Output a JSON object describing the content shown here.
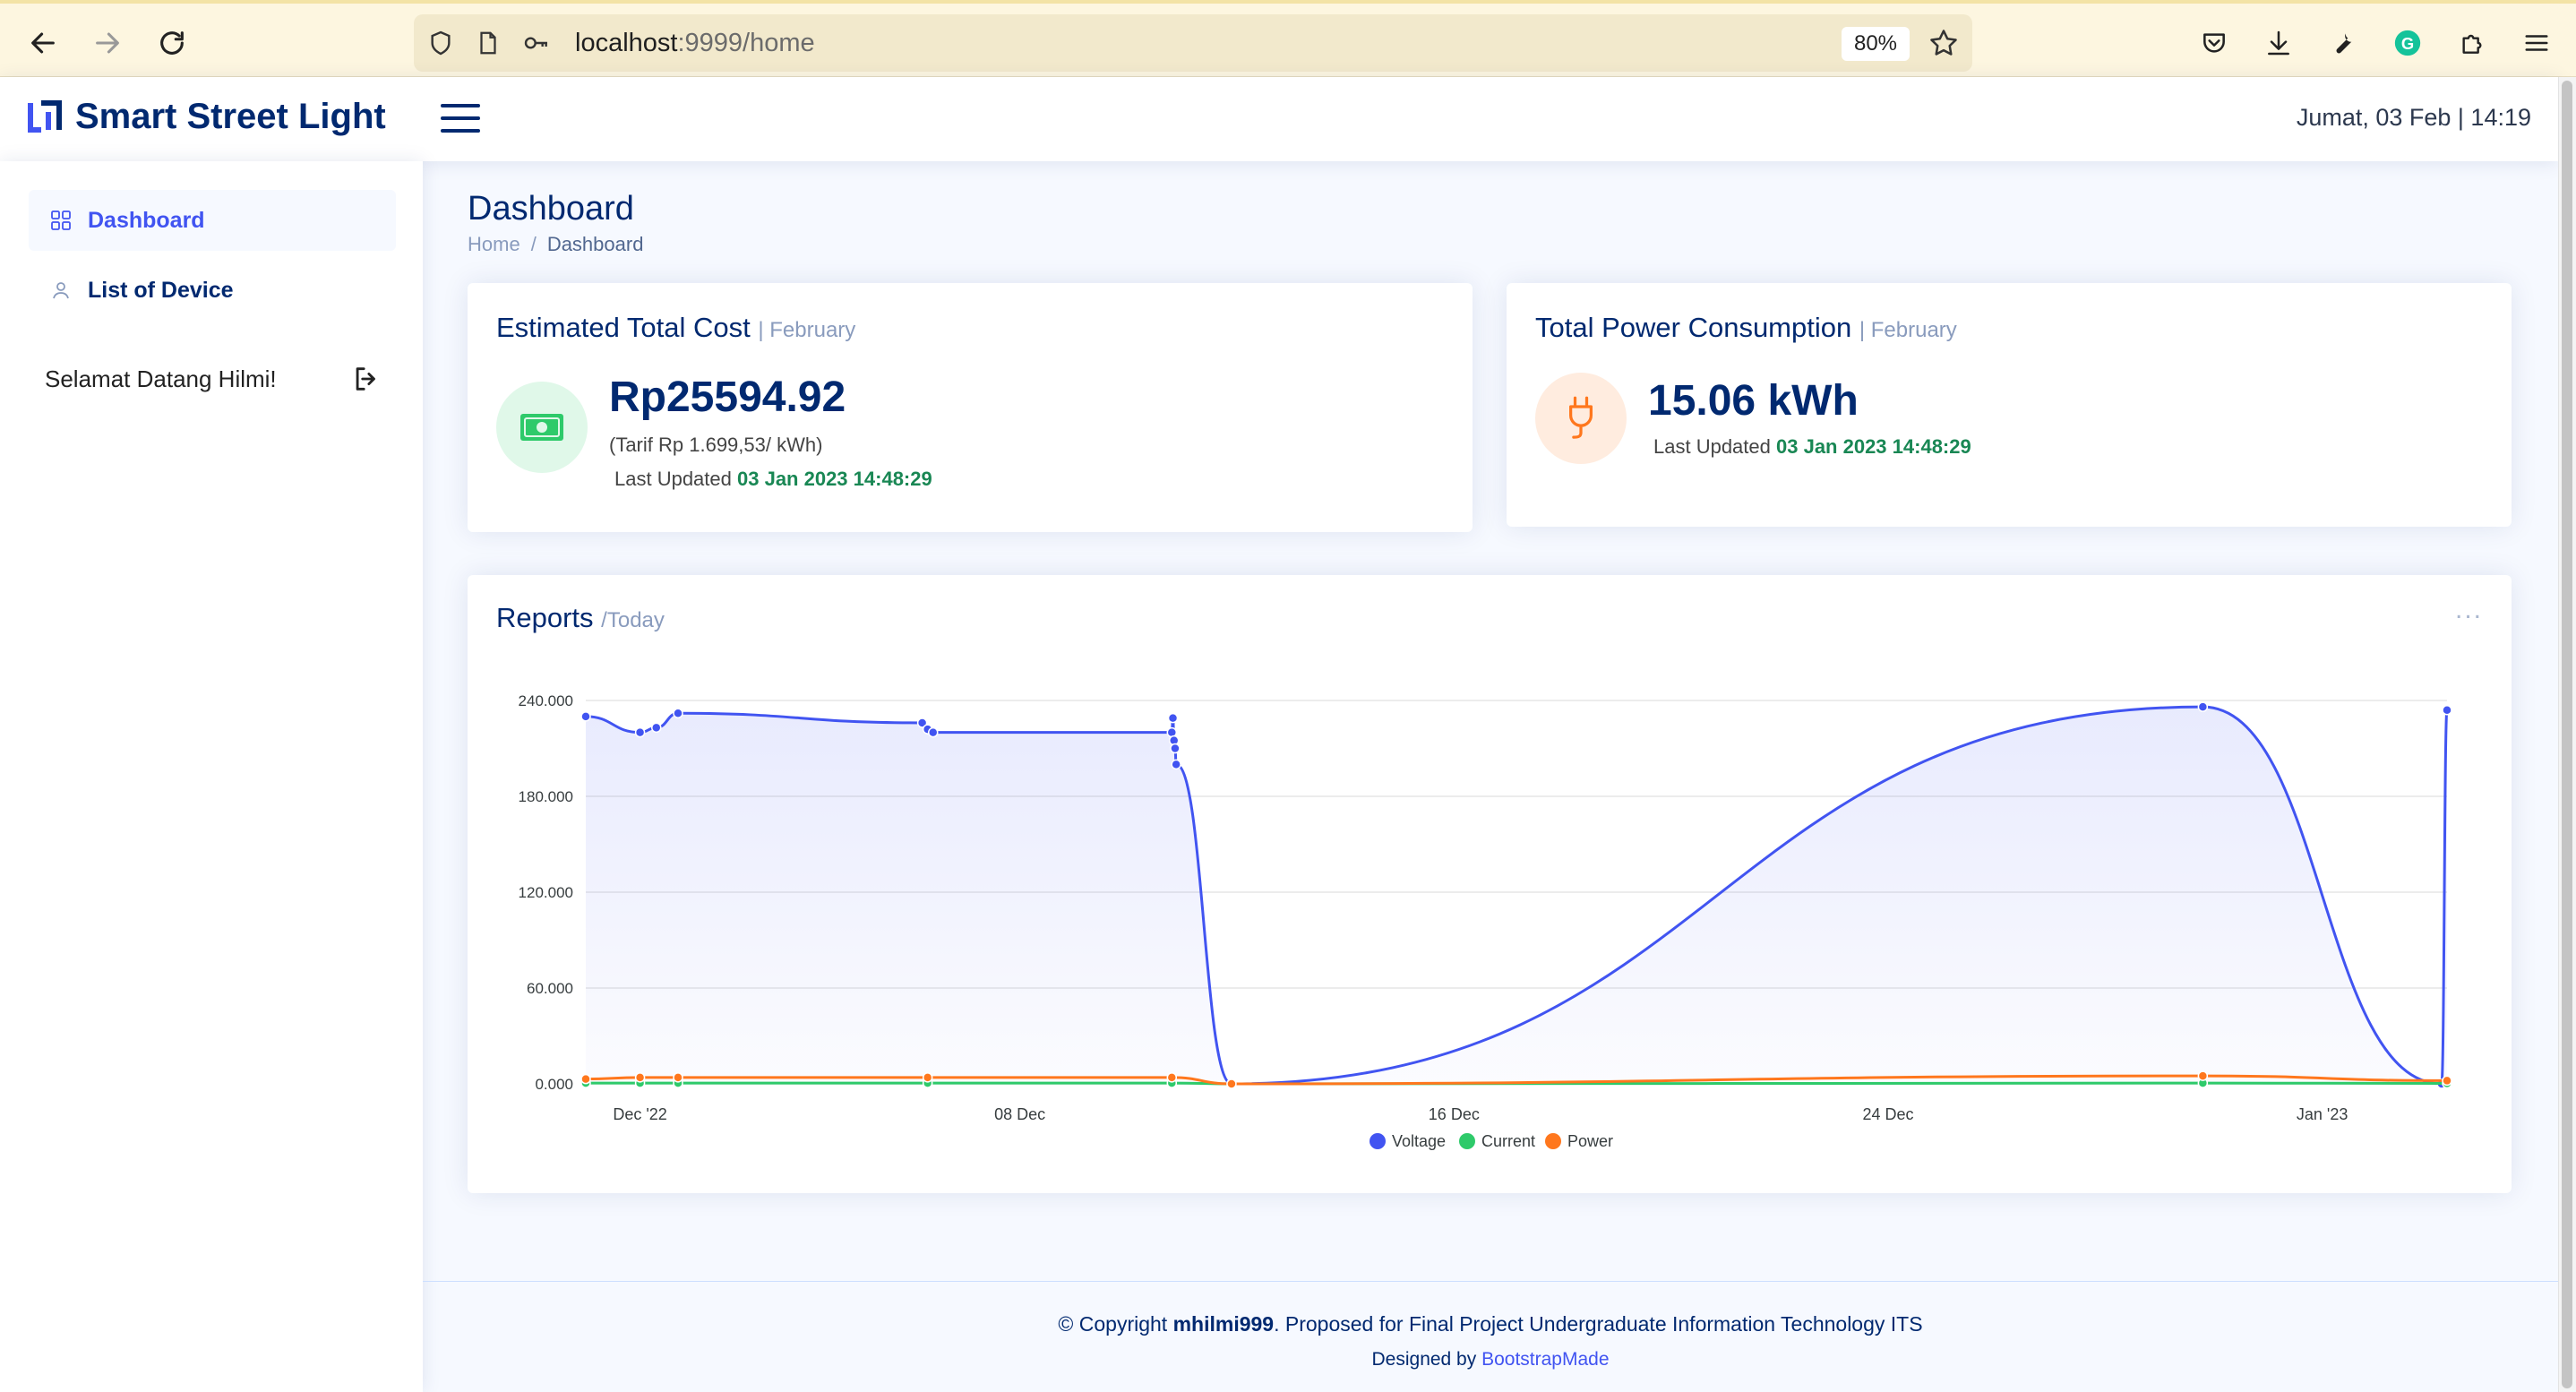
{
  "browser": {
    "url_host": "localhost",
    "url_rest": ":9999/home",
    "zoom": "80%"
  },
  "header": {
    "logo_text": "Smart Street Light",
    "datetime": "Jumat, 03 Feb | 14:19"
  },
  "sidebar": {
    "items": [
      {
        "label": "Dashboard",
        "icon": "grid-icon",
        "active": true
      },
      {
        "label": "List of Device",
        "icon": "person-icon",
        "active": false
      }
    ],
    "welcome": "Selamat Datang Hilmi!"
  },
  "page": {
    "title": "Dashboard",
    "breadcrumb": [
      "Home",
      "/",
      "Dashboard"
    ]
  },
  "cost_card": {
    "title": "Estimated Total Cost",
    "period": "| February",
    "value": "Rp25594.92",
    "tariff": "(Tarif Rp 1.699,53/ kWh)",
    "updated_label": "Last Updated",
    "updated_value": "03 Jan 2023 14:48:29",
    "accent": "#2eca6a"
  },
  "power_card": {
    "title": "Total Power Consumption",
    "period": "| February",
    "value": "15.06 kWh",
    "updated_label": "Last Updated",
    "updated_value": "03 Jan 2023 14:48:29",
    "accent": "#ff771d"
  },
  "reports": {
    "title": "Reports",
    "period": "/Today",
    "menu": "..."
  },
  "chart_data": {
    "type": "area",
    "title": "",
    "xlabel": "",
    "ylabel": "",
    "ylim": [
      0,
      240
    ],
    "yticks": [
      "240.000",
      "180.000",
      "120.000",
      "60.000",
      "0.000"
    ],
    "ytick_values": [
      240,
      180,
      120,
      60,
      0
    ],
    "xticks": [
      "Dec '22",
      "08 Dec",
      "16 Dec",
      "24 Dec",
      "Jan '23"
    ],
    "xtick_days": [
      0,
      7,
      15,
      23,
      31
    ],
    "xlim_days": [
      -1,
      33.3
    ],
    "legend_position": "bottom",
    "series": [
      {
        "name": "Voltage",
        "color": "#4154f1",
        "points": [
          [
            -1.0,
            230
          ],
          [
            0.0,
            220
          ],
          [
            0.3,
            223
          ],
          [
            0.7,
            232
          ],
          [
            5.2,
            226
          ],
          [
            5.3,
            222
          ],
          [
            5.4,
            220
          ],
          [
            9.8,
            220
          ],
          [
            9.82,
            229
          ],
          [
            9.84,
            215
          ],
          [
            9.86,
            210
          ],
          [
            9.88,
            200
          ],
          [
            10.9,
            0
          ],
          [
            28.8,
            236
          ],
          [
            33.2,
            0
          ],
          [
            33.3,
            234
          ]
        ]
      },
      {
        "name": "Current",
        "color": "#2eca6a",
        "points": [
          [
            -1.0,
            0.5
          ],
          [
            0.0,
            0.5
          ],
          [
            0.7,
            0.5
          ],
          [
            5.3,
            0.5
          ],
          [
            9.8,
            0.5
          ],
          [
            10.9,
            0.0
          ],
          [
            28.8,
            0.5
          ],
          [
            33.3,
            0.3
          ]
        ]
      },
      {
        "name": "Power",
        "color": "#ff771d",
        "points": [
          [
            -1.0,
            3
          ],
          [
            0.0,
            4
          ],
          [
            0.7,
            4
          ],
          [
            5.3,
            4
          ],
          [
            9.8,
            4
          ],
          [
            10.9,
            0
          ],
          [
            28.8,
            5
          ],
          [
            33.3,
            2
          ]
        ]
      }
    ]
  },
  "footer": {
    "copyright_prefix": "© Copyright ",
    "author": "mhilmi999",
    "copyright_suffix": ". Proposed for Final Project Undergraduate Information Technology ITS",
    "designed_prefix": "Designed by ",
    "designed_link": "BootstrapMade"
  }
}
